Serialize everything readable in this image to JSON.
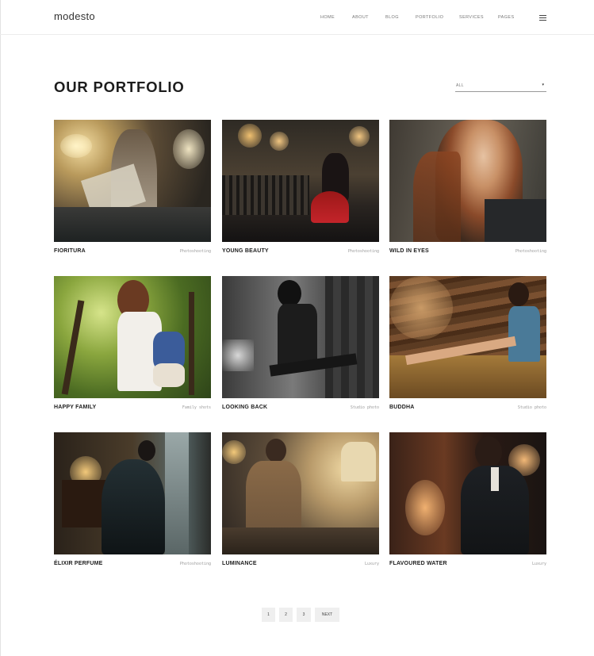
{
  "header": {
    "logo": "modesto",
    "nav": [
      "HOME",
      "ABOUT",
      "BLOG",
      "PORTFOLIO",
      "SERVICES",
      "PAGES"
    ],
    "menu_icon": "hamburger-icon"
  },
  "page": {
    "title": "OUR PORTFOLIO",
    "filter": {
      "selected": "ALL",
      "caret": "▾"
    }
  },
  "portfolio": [
    {
      "title": "FIORITURA",
      "category": "Photoshooting"
    },
    {
      "title": "YOUNG BEAUTY",
      "category": "Photoshooting"
    },
    {
      "title": "WILD IN EYES",
      "category": "Photoshooting"
    },
    {
      "title": "HAPPY FAMILY",
      "category": "Family shots"
    },
    {
      "title": "LOOKING BACK",
      "category": "Studio photo"
    },
    {
      "title": "BUDDHA",
      "category": "Studio photo"
    },
    {
      "title": "ÉLIXIR PERFUME",
      "category": "Photoshooting"
    },
    {
      "title": "LUMINANCE",
      "category": "Luxury"
    },
    {
      "title": "FLAVOURED WATER",
      "category": "Luxury"
    }
  ],
  "pagination": {
    "pages": [
      "1",
      "2",
      "3"
    ],
    "next": "NEXT"
  }
}
